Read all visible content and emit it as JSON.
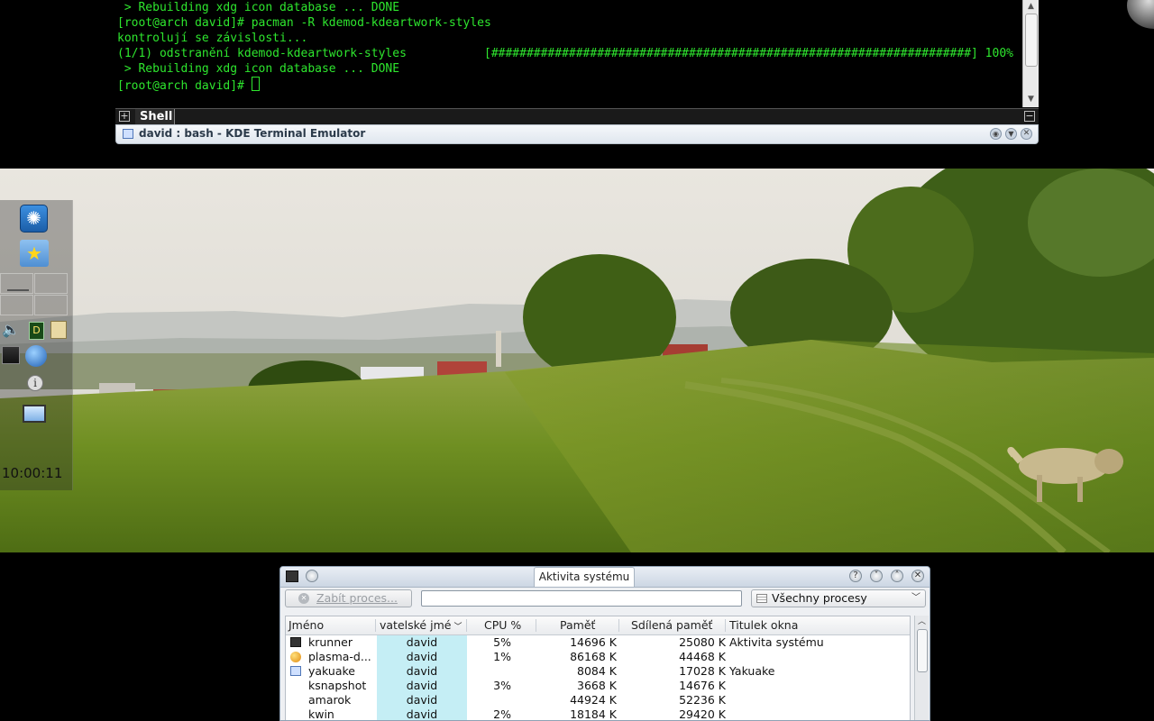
{
  "terminal": {
    "lines": [
      " > Rebuilding xdg icon database ... DONE",
      "[root@arch david]# pacman -R kdemod-kdeartwork-styles",
      "kontrolují se závislosti...",
      "(1/1) odstranění kdemod-kdeartwork-styles           [####################################################################] 100%",
      " > Rebuilding xdg icon database ... DONE",
      "[root@arch david]# "
    ],
    "tab_label": "Shell",
    "window_title": "david : bash - KDE Terminal Emulator",
    "text_color": "#2ee62e"
  },
  "panel": {
    "clock": "10:00:11",
    "icons": [
      "kickoff-icon",
      "favorites-folder-icon",
      "pager-icon",
      "volume-icon",
      "dictionary-icon",
      "clipboard-icon",
      "network-icon",
      "browser-icon",
      "info-icon",
      "display-icon"
    ]
  },
  "system_activity": {
    "title_tab": "Aktivita systému",
    "kill_button": "Zabít proces...",
    "search_value": "",
    "filter_value": "Všechny procesy",
    "columns": [
      "Jméno",
      "vatelské jmé",
      "CPU %",
      "Paměť",
      "Sdílená paměť",
      "Titulek okna"
    ],
    "rows": [
      {
        "name": "krunner",
        "user": "david",
        "cpu": "5%",
        "mem": "14696 K",
        "shared": "25080 K",
        "title": "Aktivita systému",
        "icon": "terminal-app-icon"
      },
      {
        "name": "plasma-d...",
        "user": "david",
        "cpu": "1%",
        "mem": "86168 K",
        "shared": "44468 K",
        "title": "",
        "icon": "plasma-icon"
      },
      {
        "name": "yakuake",
        "user": "david",
        "cpu": "",
        "mem": "8084 K",
        "shared": "17028 K",
        "title": "Yakuake",
        "icon": "window-app-icon"
      },
      {
        "name": "ksnapshot",
        "user": "david",
        "cpu": "3%",
        "mem": "3668 K",
        "shared": "14676 K",
        "title": "",
        "icon": ""
      },
      {
        "name": "amarok",
        "user": "david",
        "cpu": "",
        "mem": "44924 K",
        "shared": "52236 K",
        "title": "",
        "icon": ""
      },
      {
        "name": "kwin",
        "user": "david",
        "cpu": "2%",
        "mem": "18184 K",
        "shared": "29420 K",
        "title": "",
        "icon": ""
      }
    ]
  }
}
